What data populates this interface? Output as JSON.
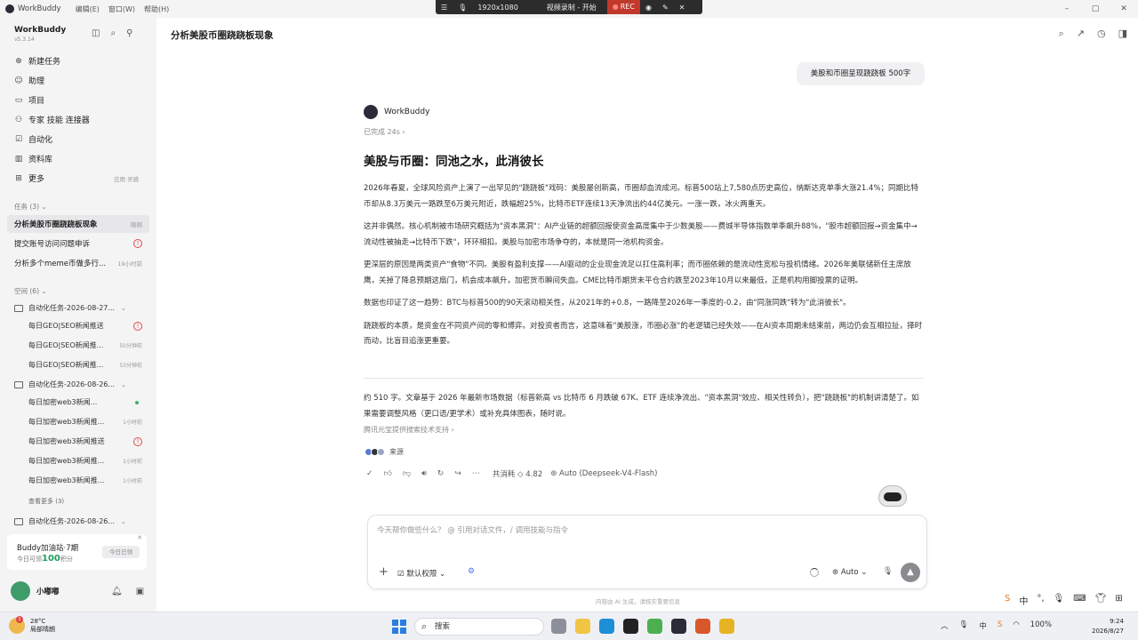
{
  "titlebar": {
    "app_name": "WorkBuddy",
    "menus": [
      "编辑(E)",
      "窗口(W)",
      "帮助(H)"
    ],
    "controls": [
      "–",
      "▢",
      "✕"
    ]
  },
  "recorder": {
    "resolution": "1920x1080",
    "status": "视频录制 - 开始",
    "rec": "REC"
  },
  "sidebar": {
    "brand": "WorkBuddy",
    "version": "v5.3.14",
    "nav": [
      {
        "label": "新建任务",
        "icon": "plus-circle-icon",
        "glyph": "⊕"
      },
      {
        "label": "助理",
        "icon": "assistant-icon",
        "glyph": "☺"
      },
      {
        "label": "项目",
        "icon": "project-icon",
        "glyph": "▭"
      },
      {
        "label": "专家 技能 连接器",
        "icon": "expert-icon",
        "glyph": "⚇"
      },
      {
        "label": "自动化",
        "icon": "automation-icon",
        "glyph": "☑"
      },
      {
        "label": "资料库",
        "icon": "library-icon",
        "glyph": "▥"
      },
      {
        "label": "更多",
        "icon": "more-icon",
        "glyph": "⊞",
        "extra": "应用·灵感"
      }
    ],
    "tasks_header": "任务 (3)",
    "tasks": [
      {
        "label": "分析美股币圈跷跷板现象",
        "meta": "刚刚",
        "active": true
      },
      {
        "label": "提交账号访问问题申诉",
        "meta": "!"
      },
      {
        "label": "分析多个meme币做多行...",
        "meta": "19小时前"
      }
    ],
    "space_header": "空间 (6)",
    "groups": [
      {
        "label": "自动化任务-2026-08-27...",
        "items": [
          {
            "label": "每日GEO|SEO新闻推送",
            "meta": "!"
          },
          {
            "label": "每日GEO|SEO新闻推...",
            "meta": "50分钟前"
          },
          {
            "label": "每日GEO|SEO新闻推...",
            "meta": "53分钟前"
          }
        ]
      },
      {
        "label": "自动化任务-2026-08-26...",
        "items": [
          {
            "label": "每日加密web3新闻...",
            "meta": "dot"
          },
          {
            "label": "每日加密web3新闻推...",
            "meta": "1小时前"
          },
          {
            "label": "每日加密web3新闻推送",
            "meta": "!"
          },
          {
            "label": "每日加密web3新闻推...",
            "meta": "1小时前"
          },
          {
            "label": "每日加密web3新闻推...",
            "meta": "1小时前"
          }
        ]
      },
      {
        "label": "自动化任务-2026-08-26...",
        "items": []
      }
    ],
    "see_more": "查看更多 (3)",
    "promo": {
      "title": "Buddy加油站·7期",
      "sub_prefix": "今日可领",
      "points": "100",
      "sub_suffix": "积分",
      "button": "今日已领"
    },
    "user": {
      "name": "小嘟嘟"
    }
  },
  "main": {
    "title": "分析美股币圈跷跷板现象",
    "user_message": "美股和币圈呈现跷跷板 500字",
    "bot_name": "WorkBuddy",
    "done": "已完成 24s ›",
    "article_title": "美股与币圈：同池之水，此消彼长",
    "paragraphs": [
      "2026年春夏，全球风险资产上演了一出罕见的\"跷跷板\"戏码：美股屡创新高，币圈却血流成河。标普500站上7,580点历史高位，纳斯达克单季大涨21.4%；同期比特币却从8.3万美元一路跌至6万美元附近，跌幅超25%，比特币ETF连续13天净流出约44亿美元。一涨一跌，冰火两重天。",
      "这并非偶然。核心机制被市场研究概括为\"资本黑洞\"：AI产业链的超额回报使资金高度集中于少数美股——费城半导体指数单季飙升88%，\"股市超额回报→资金集中→流动性被抽走→比特币下跌\"，环环相扣。美股与加密市场争夺的，本就是同一池机构资金。",
      "更深层的原因是两类资产\"食物\"不同。美股有盈利支撑——AI驱动的企业现金流足以扛住高利率；而币圈依赖的是流动性宽松与投机情绪。2026年美联储新任主席放鹰，关掉了降息预期这扇门，机会成本飙升，加密货币瞬间失血。CME比特币期货未平仓合约跌至2023年10月以来最低，正是机构用脚投票的证明。",
      "数据也印证了这一趋势：BTC与标普500的90天滚动相关性，从2021年的+0.8，一路降至2026年一季度的-0.2，由\"同涨同跌\"转为\"此消彼长\"。",
      "跷跷板的本质，是资金在不同资产间的零和博弈。对投资者而言，这意味着\"美股涨，币圈必涨\"的老逻辑已经失效——在AI资本周期未结束前，两边仍会互相拉扯，择时而动，比盲目追涨更重要。"
    ],
    "summary": "约 510 字。文章基于 2026 年最新市场数据（标普新高 vs 比特币 6 月跌破 67K、ETF 连续净流出、\"资本黑洞\"效应、相关性转负），把\"跷跷板\"的机制讲清楚了。如果需要调整风格（更口语/更学术）或补充具体图表，随时说。",
    "search_support": "腾讯元宝提供搜索技术支持 ›",
    "source_label": "来源",
    "cost": "共消耗 ◇ 4.82",
    "model": "⊛ Auto (Deepseek-V4-Flash)",
    "composer_placeholder": "今天帮你做些什么？ @ 引用对话文件，/ 调用技能与指令",
    "permission": "默认权限 ⌄",
    "auto": "⊛ Auto ⌄",
    "disclaimer": "内容由 AI 生成，请核实重要信息"
  },
  "taskbar": {
    "temp": "28°C",
    "weather": "局部晴朗",
    "weather_badge": "1",
    "search": "搜索",
    "ime_lang": "中",
    "battery": "100%",
    "time": "9:24",
    "date": "2026/8/27"
  }
}
